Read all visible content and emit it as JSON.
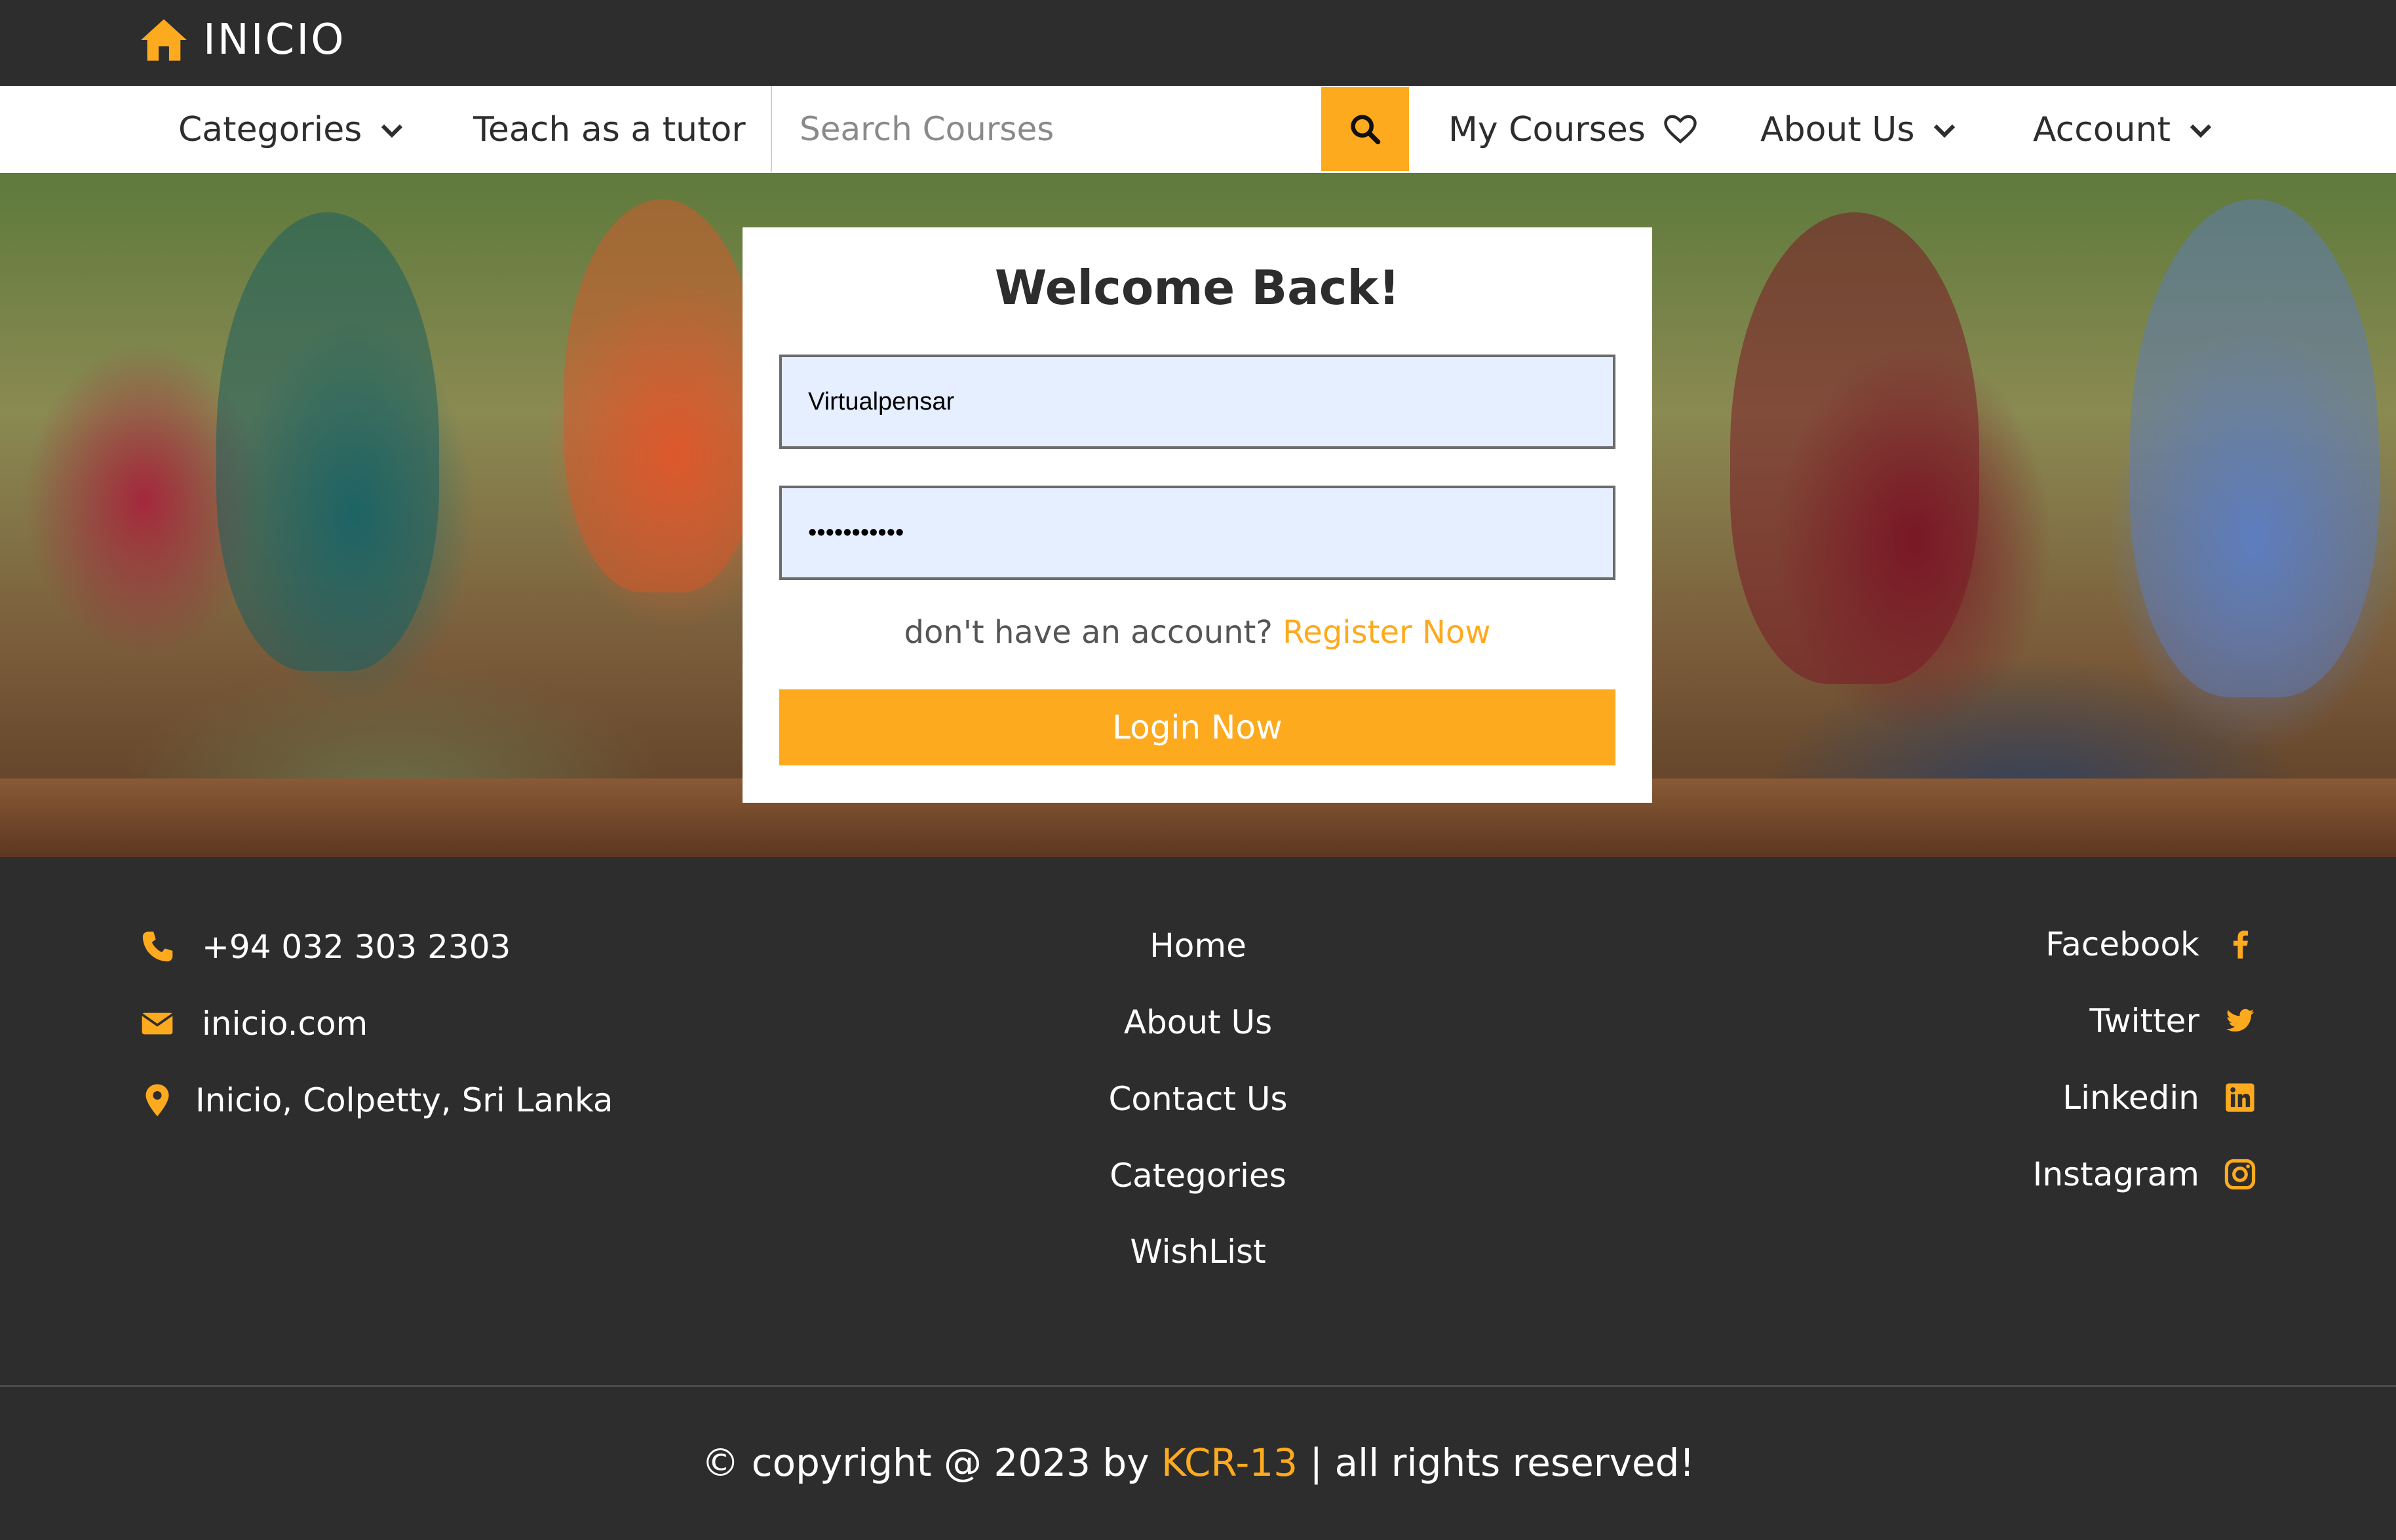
{
  "colors": {
    "accent": "#fdaa1f",
    "dark": "#2d2d2d",
    "field_bg": "#e6efff"
  },
  "brand": {
    "name": "INICIO",
    "icon": "home-icon"
  },
  "nav": {
    "categories": "Categories",
    "teach": "Teach as a tutor",
    "search_placeholder": "Search Courses",
    "my_courses": "My Courses",
    "about": "About Us",
    "account": "Account"
  },
  "login": {
    "title": "Welcome Back!",
    "username_value": "Virtualpensar",
    "password_value": "•••••••••••",
    "no_account_text": "don't have an account?",
    "register_link": "Register Now",
    "login_button": "Login Now"
  },
  "footer": {
    "contact": {
      "phone": "+94 032 303 2303",
      "website": "inicio.com",
      "address": "Inicio, Colpetty, Sri Lanka"
    },
    "links": [
      "Home",
      "About Us",
      "Contact Us",
      "Categories",
      "WishList"
    ],
    "social": [
      "Facebook",
      "Twitter",
      "Linkedin",
      "Instagram"
    ],
    "copyright": {
      "prefix": "© copyright @ 2023 by",
      "author": "KCR-13",
      "suffix": "| all rights reserved!"
    }
  }
}
